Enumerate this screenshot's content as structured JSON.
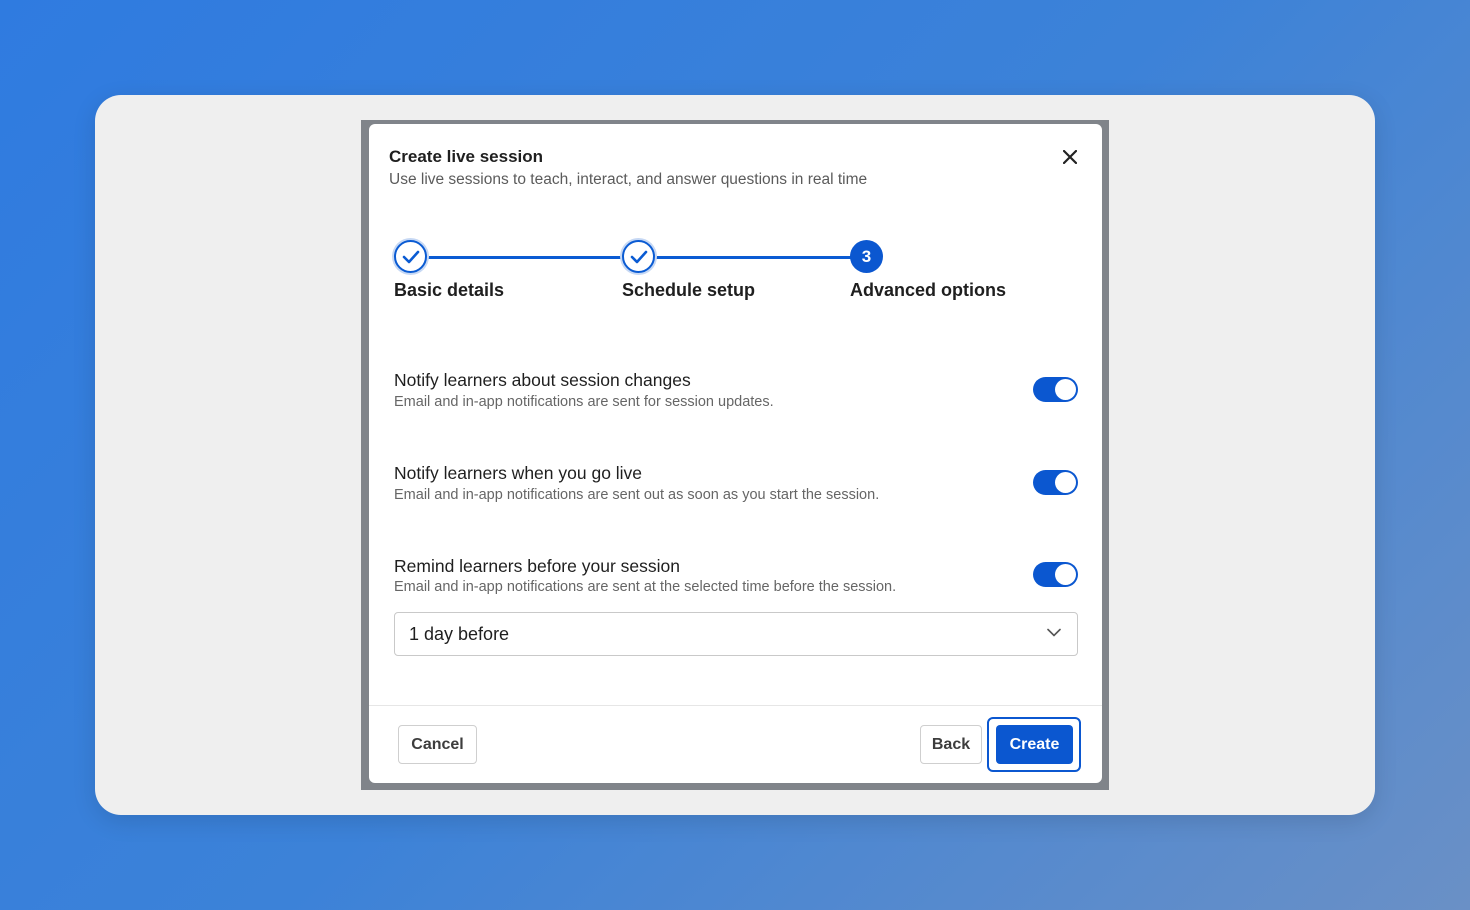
{
  "modal": {
    "title": "Create live session",
    "subtitle": "Use live sessions to teach, interact, and answer questions in real time"
  },
  "stepper": {
    "steps": [
      {
        "label": "Basic details",
        "status": "complete"
      },
      {
        "label": "Schedule setup",
        "status": "complete"
      },
      {
        "label": "Advanced options",
        "status": "current",
        "number": "3"
      }
    ]
  },
  "options": [
    {
      "title": "Notify learners about session changes",
      "description": "Email and in-app notifications are sent for session updates.",
      "enabled": true
    },
    {
      "title": "Notify learners when you go live",
      "description": "Email and in-app notifications are sent out as soon as you start the session.",
      "enabled": true
    },
    {
      "title": "Remind learners before your session",
      "description": "Email and in-app notifications are sent at the selected time before the session.",
      "enabled": true
    }
  ],
  "reminder_select": {
    "value": "1 day before"
  },
  "footer": {
    "cancel_label": "Cancel",
    "back_label": "Back",
    "create_label": "Create"
  },
  "colors": {
    "accent": "#0b57d0",
    "background_gradient_start": "#2f7be0",
    "background_gradient_end": "#6a90c6"
  },
  "icons": {
    "close": "close-icon",
    "check": "check-icon",
    "select_chevron": "chevron-down-icon"
  }
}
